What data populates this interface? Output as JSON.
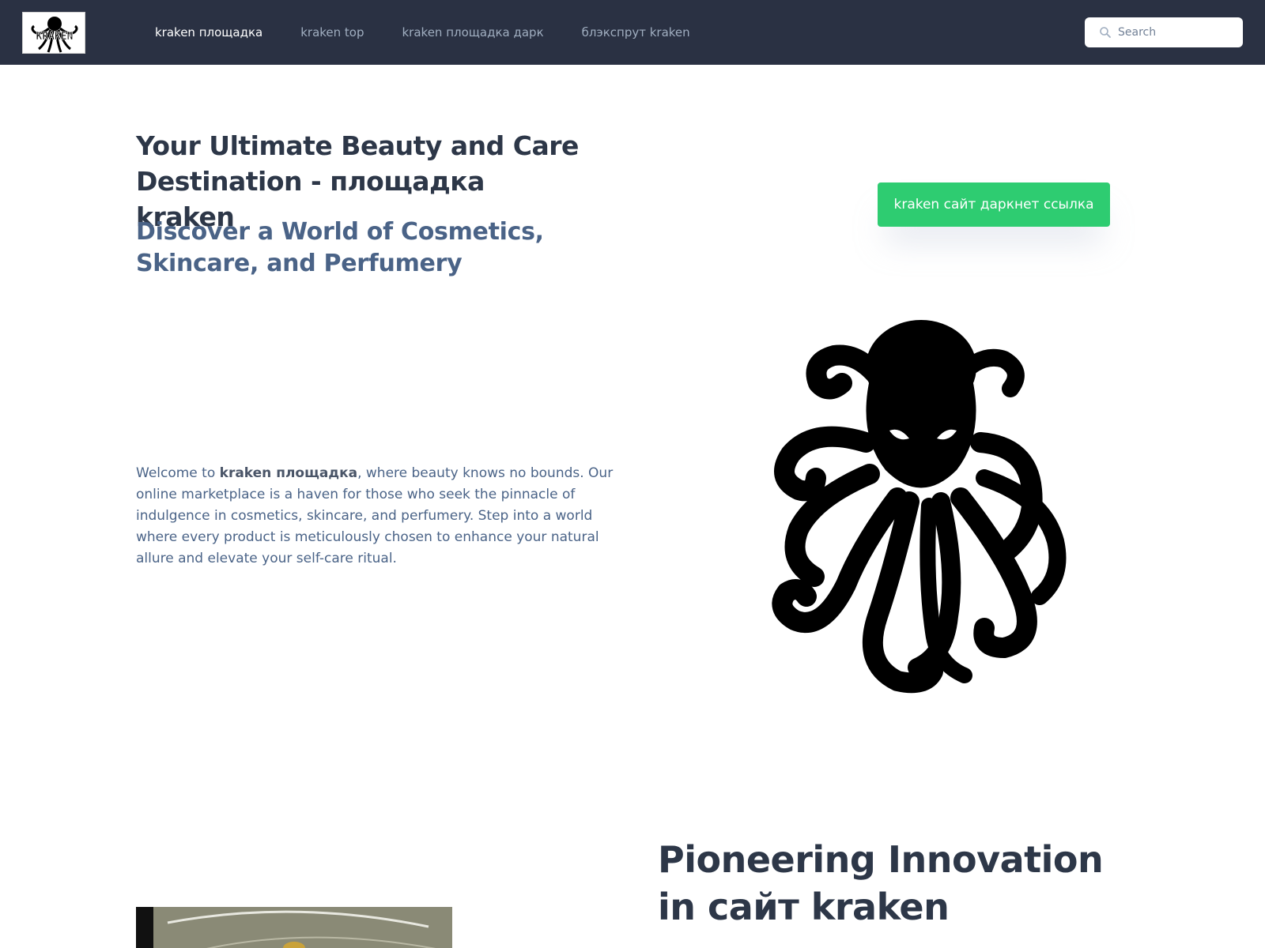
{
  "navbar": {
    "logo_text": "KRAKEN",
    "links": [
      {
        "label": "kraken площадка",
        "active": true
      },
      {
        "label": "kraken top",
        "active": false
      },
      {
        "label": "kraken площадка дарк",
        "active": false
      },
      {
        "label": "блэкспрут kraken",
        "active": false
      }
    ],
    "search": {
      "placeholder": "Search",
      "value": ""
    }
  },
  "hero": {
    "title": "Your Ultimate Beauty and Care Destination - площадка kraken",
    "subtitle": "Discover a World of Cosmetics, Skincare, and Perfumery",
    "cta_label": "kraken сайт даркнет ссылка",
    "paragraph": {
      "prefix": "Welcome to ",
      "bold": "kraken площадка",
      "suffix": ", where beauty knows no bounds. Our online marketplace is a haven for those who seek the pinnacle of indulgence in cosmetics, skincare, and perfumery. Step into a world where every product is meticulously chosen to enhance your natural allure and elevate your self-care ritual."
    }
  },
  "innovation": {
    "title": "Pioneering Innovation in сайт kraken"
  },
  "colors": {
    "navbar_bg": "#2a3143",
    "accent_green": "#2ecc71",
    "heading": "#2d3748",
    "subheading": "#4a6387"
  },
  "icons": {
    "search": "search-icon",
    "logo": "octopus-logo-icon",
    "hero_image": "octopus-icon"
  }
}
